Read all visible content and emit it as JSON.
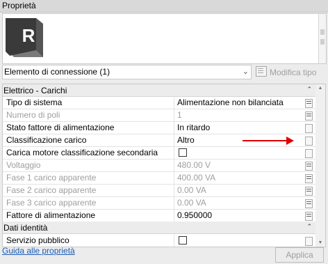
{
  "window": {
    "title": "Proprietà"
  },
  "type_selector": {
    "value": "Elemento di connessione (1)",
    "logo_letter": "R"
  },
  "edit_type": {
    "label": "Modifica tipo"
  },
  "groups": [
    {
      "title": "Elettrico - Carichi"
    },
    {
      "title": "Dati identità"
    }
  ],
  "rows": [
    {
      "name": "Tipo di sistema",
      "value": "Alimentazione non bilanciata",
      "disabled": false
    },
    {
      "name": "Numero di poli",
      "value": "1",
      "disabled": true
    },
    {
      "name": "Stato fattore di alimentazione",
      "value": "In ritardo",
      "disabled": false
    },
    {
      "name": "Classificazione carico",
      "value": "Altro",
      "disabled": false
    },
    {
      "name": "Carica motore classificazione secondaria",
      "value": "",
      "checkbox": true,
      "checked": false,
      "disabled": false
    },
    {
      "name": "Voltaggio",
      "value": "480.00 V",
      "disabled": true
    },
    {
      "name": "Fase 1 carico apparente",
      "value": "400.00 VA",
      "disabled": true
    },
    {
      "name": "Fase 2 carico apparente",
      "value": "0.00 VA",
      "disabled": true
    },
    {
      "name": "Fase 3 carico apparente",
      "value": "0.00 VA",
      "disabled": true
    },
    {
      "name": "Fattore di alimentazione",
      "value": "0.950000",
      "disabled": false
    },
    {
      "name": "Servizio pubblico",
      "value": "",
      "checkbox": true,
      "checked": false,
      "disabled": false
    }
  ],
  "footer": {
    "help_link": "Guida alle proprietà",
    "apply_label": "Applica"
  },
  "colors": {
    "annotation_arrow": "#e00000",
    "link": "#1b5bb7",
    "disabled_text": "#9e9e9e"
  }
}
